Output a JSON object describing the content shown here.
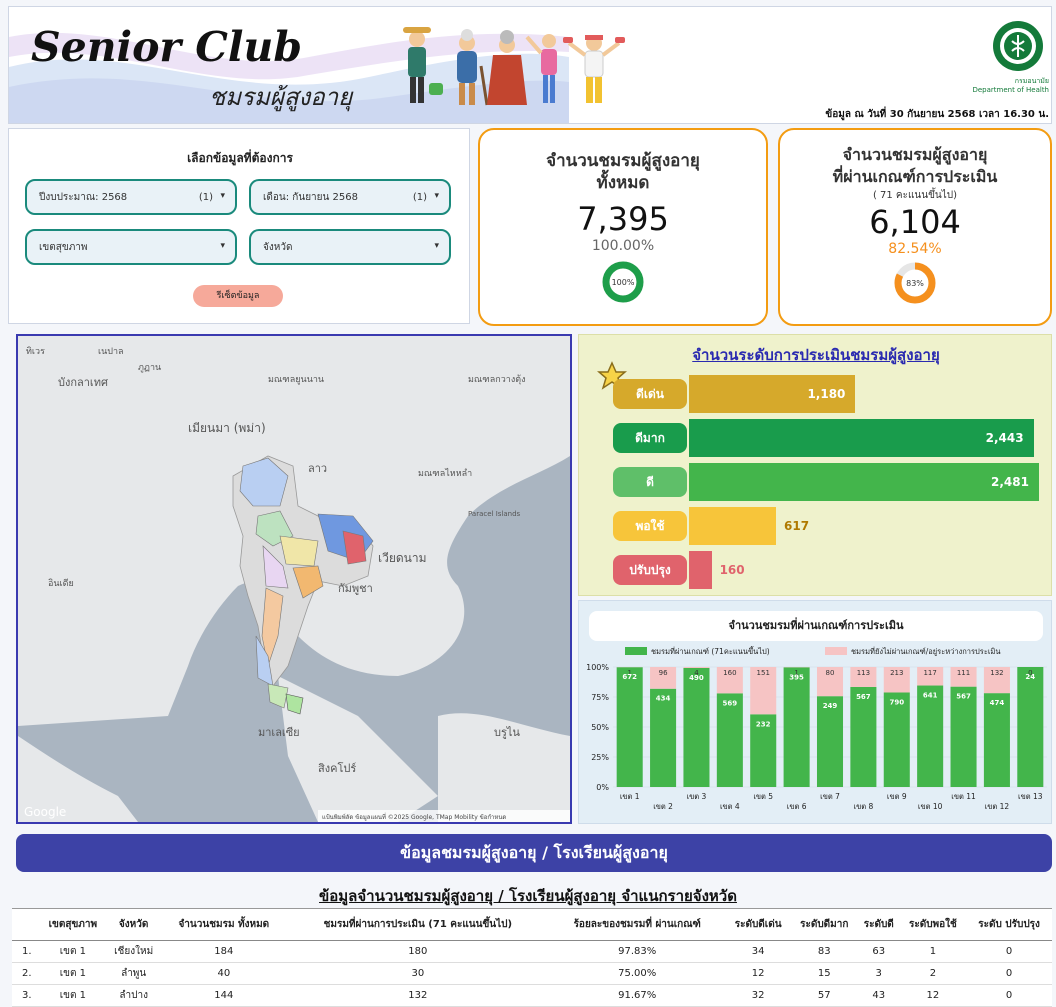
{
  "header": {
    "title_en": "Senior Club",
    "title_th": "ชมรมผู้สูงอายุ",
    "department_th": "กรมอนามัย",
    "department_en": "Department of Health",
    "data_date": "ข้อมูล ณ วันที่ 30 กันยายน  2568 เวลา 16.30 น."
  },
  "filters": {
    "title": "เลือกข้อมูลที่ต้องการ",
    "fiscal_year": {
      "label": "ปีงบประมาณ: 2568",
      "count": "(1)"
    },
    "month": {
      "label": "เดือน: กันยายน 2568",
      "count": "(1)"
    },
    "health_region": {
      "label": "เขตสุขภาพ"
    },
    "province": {
      "label": "จังหวัด"
    },
    "reset_label": "รีเซ็ตข้อมูล"
  },
  "kpi_total": {
    "title_line1": "จำนวนชมรมผู้สูงอายุ",
    "title_line2": "ทั้งหมด",
    "value": "7,395",
    "percent": "100.00%",
    "donut_label": "100%",
    "fraction": 1.0,
    "color": "#1e9e4a"
  },
  "kpi_passed": {
    "title_line1": "จำนวนชมรมผู้สูงอายุ",
    "title_line2": "ที่ผ่านเกณฑ์การประเมิน",
    "subtitle": "( 71 คะแนนขึ้นไป)",
    "value": "6,104",
    "percent": "82.54%",
    "donut_label": "83%",
    "fraction": 0.8254,
    "color": "#f5901e"
  },
  "map": {
    "labels": [
      "ทิเวร",
      "เนปาล",
      "ภูฏาน",
      "บังกลาเทศ",
      "อินเดีย",
      "เมียนมา (พม่า)",
      "ลาว",
      "มณฑลยูนนาน",
      "มณฑลกวางตุ้ง",
      "มณฑลไหหลำ",
      "Paracel Islands",
      "เวียดนาม",
      "กัมพูชา",
      "มาเลเซีย",
      "สิงคโปร์",
      "บรูไน",
      "Google"
    ],
    "attribution": "แป้นพิมพ์ลัด   ข้อมูลแผนที่ ©2025 Google, TMap Mobility   ข้อกำหนด"
  },
  "levels": {
    "title": "จำนวนระดับการประเมินชมรมผู้สูงอายุ",
    "items": [
      {
        "label": "ดีเด่น",
        "value": 1180,
        "display": "1,180",
        "color": "#d6a92b",
        "label_color": "#d6a92b"
      },
      {
        "label": "ดีมาก",
        "value": 2443,
        "display": "2,443",
        "color": "#199c4c",
        "label_color": "#199c4c"
      },
      {
        "label": "ดี",
        "value": 2481,
        "display": "2,481",
        "color": "#43b54b",
        "label_color": "#5fbf69"
      },
      {
        "label": "พอใช้",
        "value": 617,
        "display": "617",
        "color": "#f7c53a",
        "label_color": "#f7c53a"
      },
      {
        "label": "ปรับปรุง",
        "value": 160,
        "display": "160",
        "color": "#e0636c",
        "label_color": "#e0636c"
      }
    ]
  },
  "chart_data": {
    "type": "bar",
    "title": "จำนวนชมรมที่ผ่านเกณฑ์การประเมิน",
    "categories": [
      "เขต 1",
      "เขต 2",
      "เขต 3",
      "เขต 4",
      "เขต 5",
      "เขต 6",
      "เขต 7",
      "เขต 8",
      "เขต 9",
      "เขต 10",
      "เขต 11",
      "เขต 12",
      "เขต 13"
    ],
    "series": [
      {
        "name": "ชมรมที่ผ่านเกณฑ์ (71คะแนนขึ้นไป)",
        "values": [
          672,
          434,
          490,
          569,
          232,
          395,
          249,
          567,
          790,
          641,
          567,
          474,
          24
        ],
        "color": "#43b54b"
      },
      {
        "name": "ชมรมที่ยังไม่ผ่านเกณฑ์/อยู่ระหว่างการประเมิน",
        "values": [
          1,
          96,
          4,
          160,
          151,
          1,
          80,
          113,
          213,
          117,
          111,
          132,
          0
        ],
        "color": "#f6c4c4"
      }
    ],
    "y_ticks": [
      "0%",
      "25%",
      "50%",
      "75%",
      "100%"
    ],
    "stacking": "percent",
    "legend": "top"
  },
  "banner": {
    "text": "ข้อมูลชมรมผู้สูงอายุ / โรงเรียนผู้สูงอายุ"
  },
  "table": {
    "title": "ข้อมูลจำนวนชมรมผู้สูงอายุ / โรงเรียนผู้สูงอายุ จำแนกรายจังหวัด",
    "headers": [
      "",
      "เขตสุขภาพ",
      "จังหวัด",
      "จำนวนชมรม ทั้งหมด",
      "ชมรมที่ผ่านการประเมิน (71 คะแนนขึ้นไป)",
      "ร้อยละของชมรมที่ ผ่านเกณฑ์",
      "ระดับดีเด่น",
      "ระดับดีมาก",
      "ระดับดี",
      "ระดับพอใช้",
      "ระดับ ปรับปรุง"
    ],
    "rows": [
      [
        "1.",
        "เขต 1",
        "เชียงใหม่",
        "184",
        "180",
        "97.83%",
        "34",
        "83",
        "63",
        "1",
        "0"
      ],
      [
        "2.",
        "เขต 1",
        "ลำพูน",
        "40",
        "30",
        "75.00%",
        "12",
        "15",
        "3",
        "2",
        "0"
      ],
      [
        "3.",
        "เขต 1",
        "ลำปาง",
        "144",
        "132",
        "91.67%",
        "32",
        "57",
        "43",
        "12",
        "0"
      ]
    ]
  }
}
